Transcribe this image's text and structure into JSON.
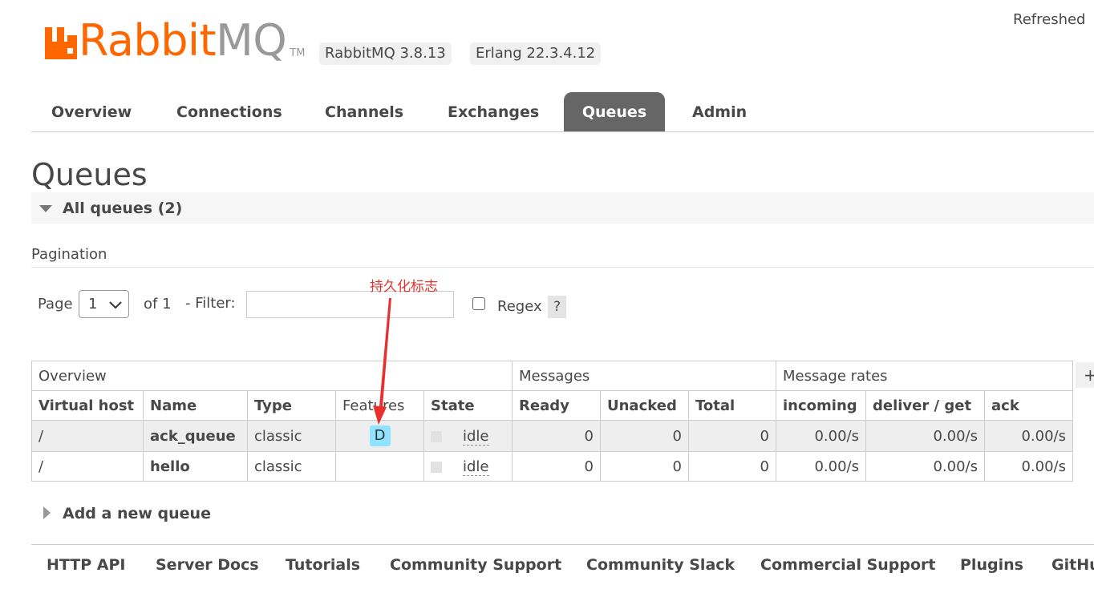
{
  "header": {
    "logo_prefix": "Rabbit",
    "logo_suffix": "MQ",
    "logo_tm": "TM",
    "version_rabbitmq": "RabbitMQ 3.8.13",
    "version_erlang": "Erlang 22.3.4.12",
    "refreshed": "Refreshed"
  },
  "tabs": [
    {
      "label": "Overview",
      "active": false
    },
    {
      "label": "Connections",
      "active": false
    },
    {
      "label": "Channels",
      "active": false
    },
    {
      "label": "Exchanges",
      "active": false
    },
    {
      "label": "Queues",
      "active": true
    },
    {
      "label": "Admin",
      "active": false
    }
  ],
  "page_title": "Queues",
  "section": {
    "title": "All queues (2)"
  },
  "pagination": {
    "label": "Pagination",
    "page_label": "Page",
    "page_value": "1",
    "of_label": "of 1",
    "filter_label": "- Filter:",
    "filter_value": "",
    "regex_label": "Regex",
    "regex_checked": false,
    "help_label": "?"
  },
  "annotation": {
    "text": "持久化标志"
  },
  "table": {
    "groups": [
      "Overview",
      "Messages",
      "Message rates"
    ],
    "plus_label": "+/-",
    "columns": [
      "Virtual host",
      "Name",
      "Type",
      "Features",
      "State",
      "Ready",
      "Unacked",
      "Total",
      "incoming",
      "deliver / get",
      "ack"
    ],
    "rows": [
      {
        "vhost": "/",
        "name": "ack_queue",
        "type": "classic",
        "features": "D",
        "state": "idle",
        "ready": "0",
        "unacked": "0",
        "total": "0",
        "incoming": "0.00/s",
        "deliver_get": "0.00/s",
        "ack": "0.00/s"
      },
      {
        "vhost": "/",
        "name": "hello",
        "type": "classic",
        "features": "",
        "state": "idle",
        "ready": "0",
        "unacked": "0",
        "total": "0",
        "incoming": "0.00/s",
        "deliver_get": "0.00/s",
        "ack": "0.00/s"
      }
    ]
  },
  "add_queue_label": "Add a new queue",
  "footer": {
    "links": [
      "HTTP API",
      "Server Docs",
      "Tutorials",
      "Community Support",
      "Community Slack",
      "Commercial Support",
      "Plugins",
      "GitHub"
    ]
  },
  "colors": {
    "brand_orange": "#ff6600",
    "active_tab": "#666666",
    "durable_badge": "#8fe3ff",
    "annotation_red": "#e2342f"
  }
}
